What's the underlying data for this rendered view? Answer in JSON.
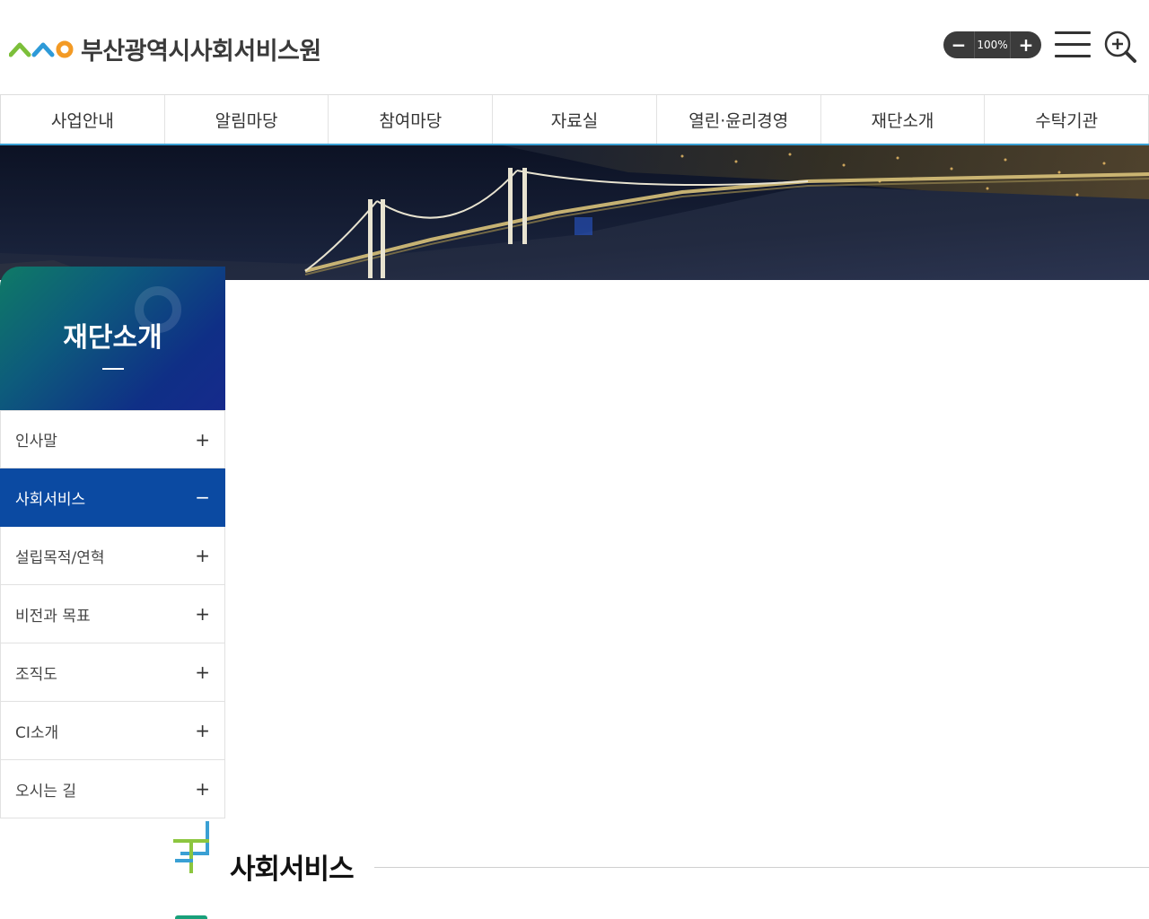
{
  "header": {
    "org_name": "부산광역시사회서비스원",
    "zoom": {
      "minus": "−",
      "value": "100%",
      "plus": "+"
    }
  },
  "gnb": {
    "items": [
      {
        "label": "사업안내"
      },
      {
        "label": "알림마당"
      },
      {
        "label": "참여마당"
      },
      {
        "label": "자료실"
      },
      {
        "label": "열린·윤리경영"
      },
      {
        "label": "재단소개"
      },
      {
        "label": "수탁기관"
      }
    ]
  },
  "lnb": {
    "title": "재단소개",
    "items": [
      {
        "label": "인사말",
        "sign": "+"
      },
      {
        "label": "사회서비스",
        "sign": "−"
      },
      {
        "label": "설립목적/연혁",
        "sign": "+"
      },
      {
        "label": "비전과 목표",
        "sign": "+"
      },
      {
        "label": "조직도",
        "sign": "+"
      },
      {
        "label": "CI소개",
        "sign": "+"
      },
      {
        "label": "오시는 길",
        "sign": "+"
      }
    ]
  },
  "content": {
    "page_title": "사회서비스"
  },
  "colors": {
    "accent_blue": "#0b4aa2",
    "gnb_underline": "#3aa0d4",
    "logo_green": "#7cbf3a",
    "logo_blue": "#2d9ad8",
    "logo_orange": "#f39a24"
  },
  "icons": {
    "logo": "logo-mark-icon",
    "menu": "hamburger-icon",
    "search": "search-zoom-icon",
    "page_title": "cross-mark-icon"
  }
}
